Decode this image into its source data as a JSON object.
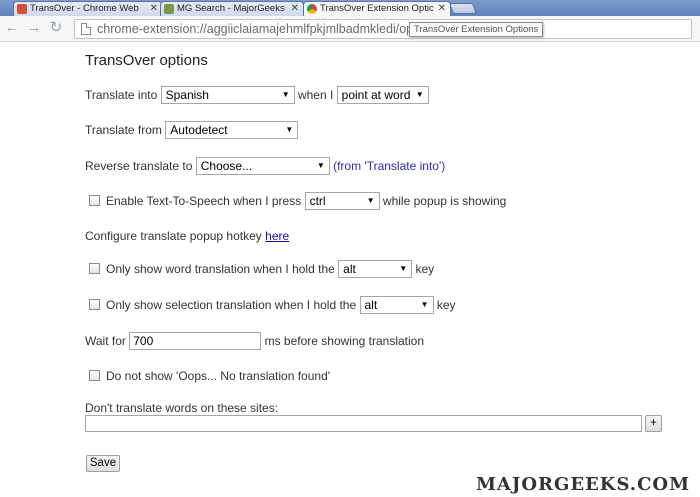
{
  "browser": {
    "tabs": [
      {
        "title": "TransOver - Chrome Web",
        "favicon_color": "#dd4b39"
      },
      {
        "title": "MG Search - MajorGeeks",
        "favicon_color": "#7a9a4a"
      },
      {
        "title": "TransOver Extension Optic",
        "favicon_color": "#4a8af4"
      }
    ],
    "close_glyph": "✕",
    "back_glyph": "←",
    "forward_glyph": "→",
    "reload_glyph": "↻",
    "address": "chrome-extension://aggiiclaiamajehmlfpkjmlbadmkledi/options.html",
    "tooltip": "TransOver Extension Options"
  },
  "page": {
    "heading": "TransOver options",
    "translate_into": {
      "label": "Translate into",
      "value": "Spanish",
      "when_label": "when I",
      "trigger_value": "point at word"
    },
    "translate_from": {
      "label": "Translate from",
      "value": "Autodetect"
    },
    "reverse_translate": {
      "label": "Reverse translate to",
      "value": "Choose...",
      "note": "(from 'Translate into')"
    },
    "tts": {
      "label": "Enable Text-To-Speech when I press",
      "key_value": "ctrl",
      "suffix": "while popup is showing"
    },
    "hotkey": {
      "label": "Configure translate popup hotkey",
      "link": "here"
    },
    "word_modifier": {
      "label": "Only show word translation when I hold the",
      "value": "alt",
      "suffix": "key"
    },
    "selection_modifier": {
      "label": "Only show selection translation when I hold the",
      "value": "alt",
      "suffix": "key"
    },
    "delay": {
      "prefix": "Wait for",
      "value": "700",
      "suffix": "ms before showing translation"
    },
    "oops": {
      "label": "Do not show 'Oops... No translation found'"
    },
    "exclude": {
      "label": "Don't translate words on these sites:",
      "value": "",
      "add_label": "+"
    },
    "save_label": "Save"
  },
  "watermark": "MAJORGEEKS.COM",
  "colors": {
    "link": "#2b2bb5",
    "tab_strip": "#6f8fc4"
  }
}
